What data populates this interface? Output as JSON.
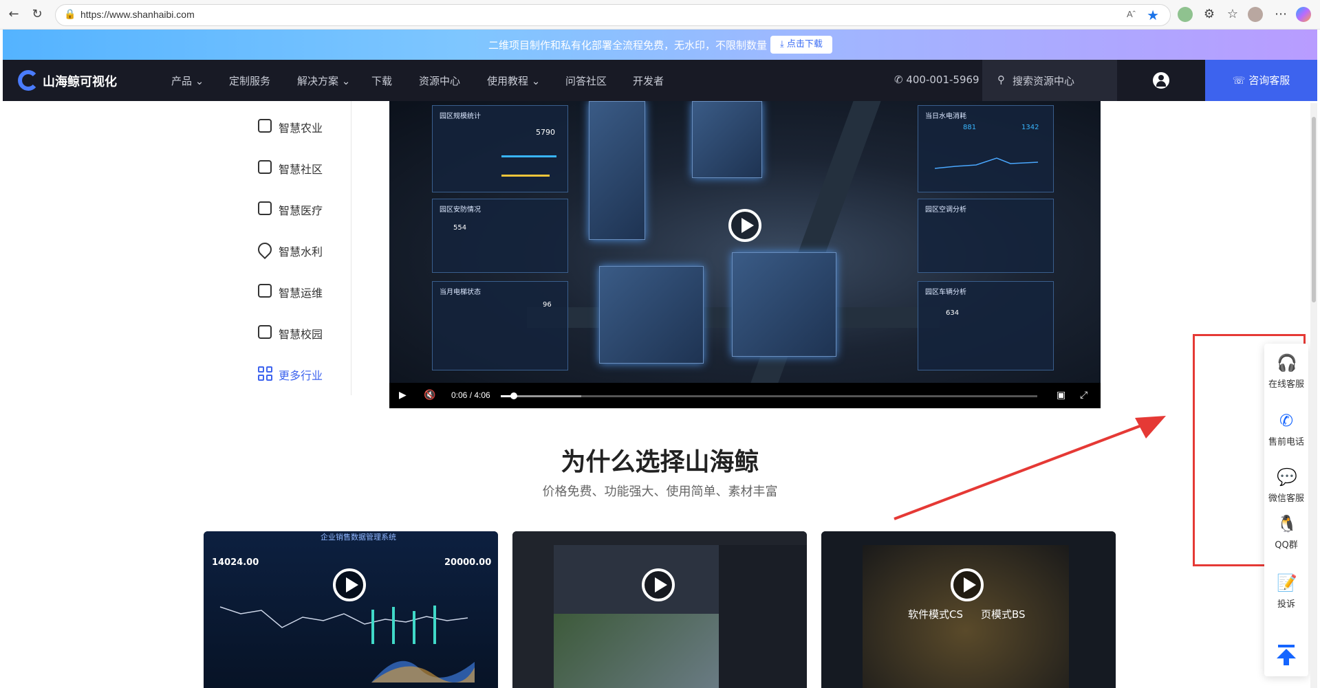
{
  "browser": {
    "url": "https://www.shanhaibi.com",
    "read_aloud": "Aˆ"
  },
  "banner": {
    "text": "二维项目制作和私有化部署全流程免费，无水印，不限制数量",
    "download_label": "⤓ 点击下载"
  },
  "nav": {
    "brand": "山海鲸可视化",
    "items": [
      {
        "label": "产品 ⌄"
      },
      {
        "label": "定制服务"
      },
      {
        "label": "解决方案 ⌄"
      },
      {
        "label": "下载"
      },
      {
        "label": "资源中心"
      },
      {
        "label": "使用教程 ⌄"
      },
      {
        "label": "问答社区"
      },
      {
        "label": "开发者"
      }
    ],
    "phone": "400-001-5969",
    "search_placeholder": "搜索资源中心",
    "consult_label": "咨询客服"
  },
  "sidebar": {
    "items": [
      {
        "label": "智慧农业",
        "icon": "sprout-icon"
      },
      {
        "label": "智慧社区",
        "icon": "community-icon"
      },
      {
        "label": "智慧医疗",
        "icon": "medical-kit-icon"
      },
      {
        "label": "智慧水利",
        "icon": "water-drop-icon"
      },
      {
        "label": "智慧运维",
        "icon": "toolbox-icon"
      },
      {
        "label": "智慧校园",
        "icon": "bus-icon"
      },
      {
        "label": "更多行业",
        "icon": "grid-icon"
      }
    ]
  },
  "video": {
    "time": "0:06 / 4:06",
    "progress": 0.024,
    "buffered": 0.15,
    "panels": {
      "stats_title": "园区规模统计",
      "energy_title": "当日水电消耗",
      "security_title": "园区安防情况",
      "aircon_title": "园区空调分析",
      "elevator_title": "当月电梯状态",
      "parking_title": "园区车辆分析",
      "area": "5790",
      "power": "881",
      "water": "1342",
      "security_count": "554",
      "elevator_pct": "96",
      "parking": "634"
    }
  },
  "section": {
    "title": "为什么选择山海鲸",
    "subtitle": "价格免费、功能强大、使用简单、素材丰富"
  },
  "thumbnails": [
    {
      "left_value": "14024.00",
      "right_value": "20000.00",
      "title": "企业销售数据管理系统"
    },
    {
      "title": ""
    },
    {
      "mode_left": "软件模式CS",
      "mode_right": "页模式BS"
    }
  ],
  "floatbar": {
    "items": [
      {
        "label": "在线客服",
        "icon": "headset-icon"
      },
      {
        "label": "售前电话",
        "icon": "phone-icon"
      },
      {
        "label": "微信客服",
        "icon": "wechat-icon"
      },
      {
        "label": "QQ群",
        "icon": "qq-icon"
      },
      {
        "label": "投诉",
        "icon": "complaint-icon"
      }
    ]
  },
  "colors": {
    "accent": "#3d63ee",
    "nav_bg": "#181a25",
    "float_blue": "#1565ff",
    "annotation_red": "#e53935"
  }
}
